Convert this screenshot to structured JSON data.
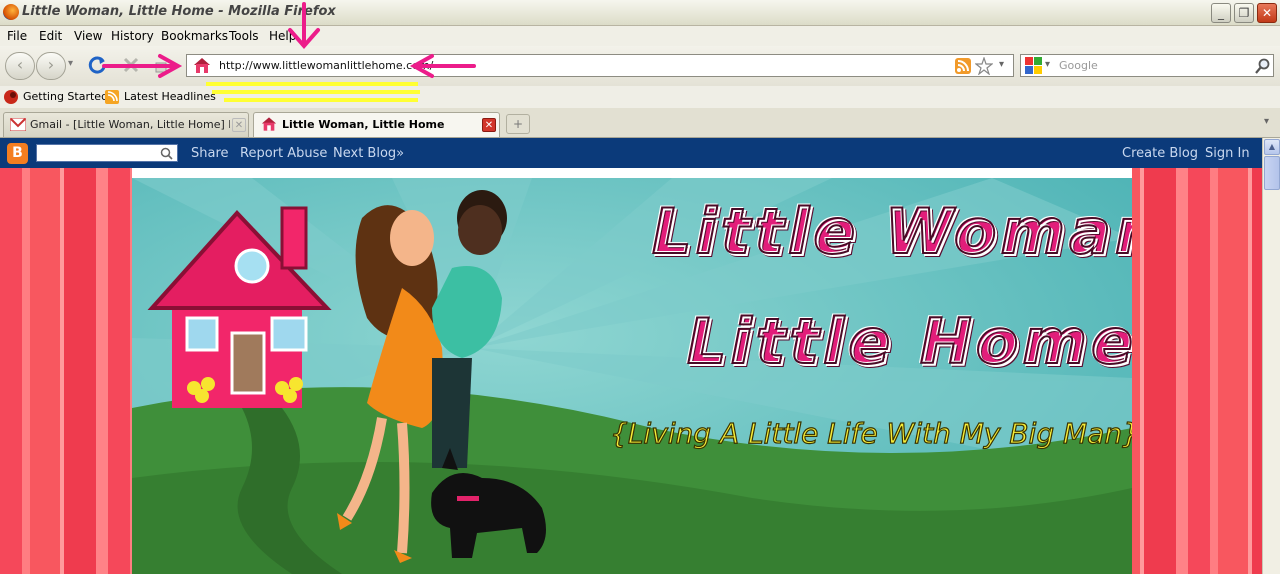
{
  "window": {
    "title": "Little Woman, Little Home - Mozilla Firefox",
    "minimize": "_",
    "maximize": "❐",
    "close": "✕"
  },
  "menu": [
    "File",
    "Edit",
    "View",
    "History",
    "Bookmarks",
    "Tools",
    "Help"
  ],
  "nav": {
    "back": "‹",
    "forward": "›",
    "dropdown": "▾",
    "url": "http://www.littlewomanlittlehome.com/",
    "search_placeholder": "Google"
  },
  "bookmarks": [
    "Getting Started",
    "Latest Headlines"
  ],
  "tabs": [
    {
      "label": "Gmail - [Little Woman, Little Home] New...",
      "close": "✕"
    },
    {
      "label": "Little Woman, Little Home",
      "close": "✕"
    }
  ],
  "tab_new": "+",
  "tab_list": "▾",
  "blogger": {
    "logo": "B",
    "links": [
      "Share",
      "Report Abuse",
      "Next Blog»"
    ],
    "right_links": [
      "Create Blog",
      "Sign In"
    ]
  },
  "blog": {
    "title_line1": "Little Woman,",
    "title_line2": "Little Home",
    "tagline": "{Living A Little Life With My Big Man}"
  },
  "colors": {
    "annotation_arrow": "#ec1c8a",
    "annotation_underline": "#ffff33",
    "blogger_bar": "#0b3a7a"
  }
}
